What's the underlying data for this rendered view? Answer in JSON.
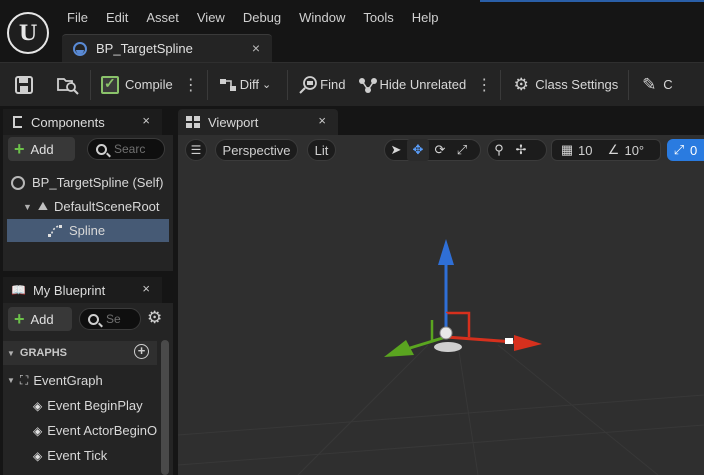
{
  "app": {
    "logo_glyph": "U"
  },
  "menu": [
    "File",
    "Edit",
    "Asset",
    "View",
    "Debug",
    "Window",
    "Tools",
    "Help"
  ],
  "document_tab": {
    "label": "BP_TargetSpline",
    "close": "×"
  },
  "toolbar": {
    "compile_label": "Compile",
    "diff_label": "Diff",
    "find_label": "Find",
    "hide_unrelated_label": "Hide Unrelated",
    "class_settings_label": "Class Settings",
    "more_glyph": "⋮",
    "cutoff_label": "C"
  },
  "components_panel": {
    "title": "Components",
    "close": "×",
    "add_label": "Add",
    "search_placeholder": "Searc",
    "items": [
      {
        "label": "BP_TargetSpline (Self)",
        "icon": "blueprint-icon"
      },
      {
        "label": "DefaultSceneRoot",
        "icon": "scene-root-icon"
      },
      {
        "label": "Spline",
        "icon": "spline-icon",
        "selected": true
      }
    ]
  },
  "my_blueprint_panel": {
    "title": "My Blueprint",
    "close": "×",
    "add_label": "Add",
    "search_placeholder": "Se",
    "graphs_header": "GRAPHS",
    "event_graph": "EventGraph",
    "events": [
      "Event BeginPlay",
      "Event ActorBeginO",
      "Event Tick"
    ]
  },
  "viewport": {
    "tab_label": "Viewport",
    "close": "×",
    "perspective_label": "Perspective",
    "lit_label": "Lit",
    "grid_snap": "10",
    "rotation_snap": "10°",
    "scale_partial": "0"
  },
  "colors": {
    "accent_blue": "#2a7be0",
    "gizmo_x": "#d6301d",
    "gizmo_y": "#5aa520",
    "gizmo_z": "#2f6fd6",
    "selection": "#465a75"
  }
}
